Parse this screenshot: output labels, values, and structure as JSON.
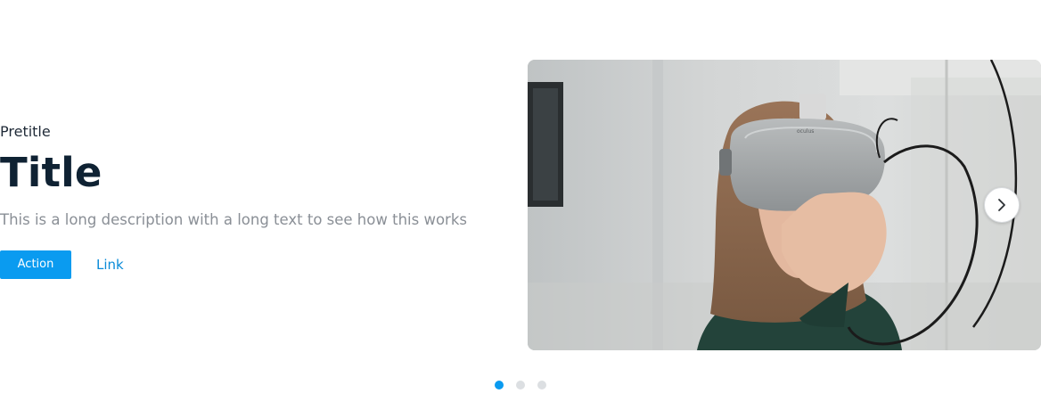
{
  "hero": {
    "pretitle": "Pretitle",
    "title": "Title",
    "description": "This is a long description with a long text to see how this works",
    "action_label": "Action",
    "link_label": "Link"
  },
  "carousel": {
    "image_alt": "Person wearing oculus VR headset",
    "headset_brand": "oculus",
    "next_icon": "chevron-right-icon",
    "dots": [
      {
        "active": true
      },
      {
        "active": false
      },
      {
        "active": false
      }
    ],
    "colors": {
      "accent": "#0a9bf0",
      "dot_inactive": "#dcdfe2"
    }
  }
}
